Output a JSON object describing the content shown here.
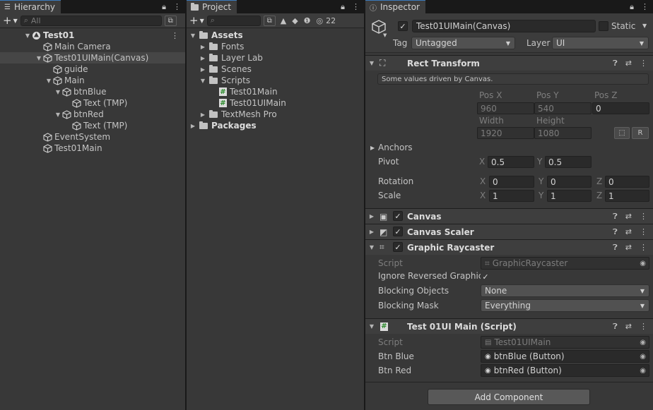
{
  "hierarchy": {
    "tab_label": "Hierarchy",
    "search_placeholder": "All",
    "scene": "Test01",
    "items": [
      {
        "label": "Main Camera"
      },
      {
        "label": "Test01UIMain(Canvas)"
      },
      {
        "label": "guide"
      },
      {
        "label": "Main"
      },
      {
        "label": "btnBlue"
      },
      {
        "label": "Text (TMP)"
      },
      {
        "label": "btnRed"
      },
      {
        "label": "Text (TMP)"
      },
      {
        "label": "EventSystem"
      },
      {
        "label": "Test01Main"
      }
    ]
  },
  "project": {
    "tab_label": "Project",
    "hidden_count": "22",
    "items": [
      {
        "label": "Assets"
      },
      {
        "label": "Fonts"
      },
      {
        "label": "Layer Lab"
      },
      {
        "label": "Scenes"
      },
      {
        "label": "Scripts"
      },
      {
        "label": "Test01Main"
      },
      {
        "label": "Test01UIMain"
      },
      {
        "label": "TextMesh Pro"
      },
      {
        "label": "Packages"
      }
    ]
  },
  "inspector": {
    "tab_label": "Inspector",
    "object_name": "Test01UIMain(Canvas)",
    "static_label": "Static",
    "tag_label": "Tag",
    "tag_value": "Untagged",
    "layer_label": "Layer",
    "layer_value": "UI",
    "rect_transform": {
      "title": "Rect Transform",
      "note": "Some values driven by Canvas.",
      "pos_x_label": "Pos X",
      "pos_y_label": "Pos Y",
      "pos_z_label": "Pos Z",
      "pos_x": "960",
      "pos_y": "540",
      "pos_z": "0",
      "width_label": "Width",
      "height_label": "Height",
      "width": "1920",
      "height": "1080",
      "r_button": "R",
      "anchors_label": "Anchors",
      "pivot_label": "Pivot",
      "pivot_x": "0.5",
      "pivot_y": "0.5",
      "rotation_label": "Rotation",
      "rot_x": "0",
      "rot_y": "0",
      "rot_z": "0",
      "scale_label": "Scale",
      "scale_x": "1",
      "scale_y": "1",
      "scale_z": "1",
      "x": "X",
      "y": "Y",
      "z": "Z"
    },
    "canvas": {
      "title": "Canvas"
    },
    "canvas_scaler": {
      "title": "Canvas Scaler"
    },
    "graphic_raycaster": {
      "title": "Graphic Raycaster",
      "script_label": "Script",
      "script_value": "GraphicRaycaster",
      "ignore_label": "Ignore Reversed Graphics",
      "blocking_objects_label": "Blocking Objects",
      "blocking_objects_value": "None",
      "blocking_mask_label": "Blocking Mask",
      "blocking_mask_value": "Everything"
    },
    "script_component": {
      "title": "Test 01UI Main (Script)",
      "script_label": "Script",
      "script_value": "Test01UIMain",
      "btn_blue_label": "Btn Blue",
      "btn_blue_value": "btnBlue (Button)",
      "btn_red_label": "Btn Red",
      "btn_red_value": "btnRed (Button)"
    },
    "add_component": "Add Component"
  }
}
